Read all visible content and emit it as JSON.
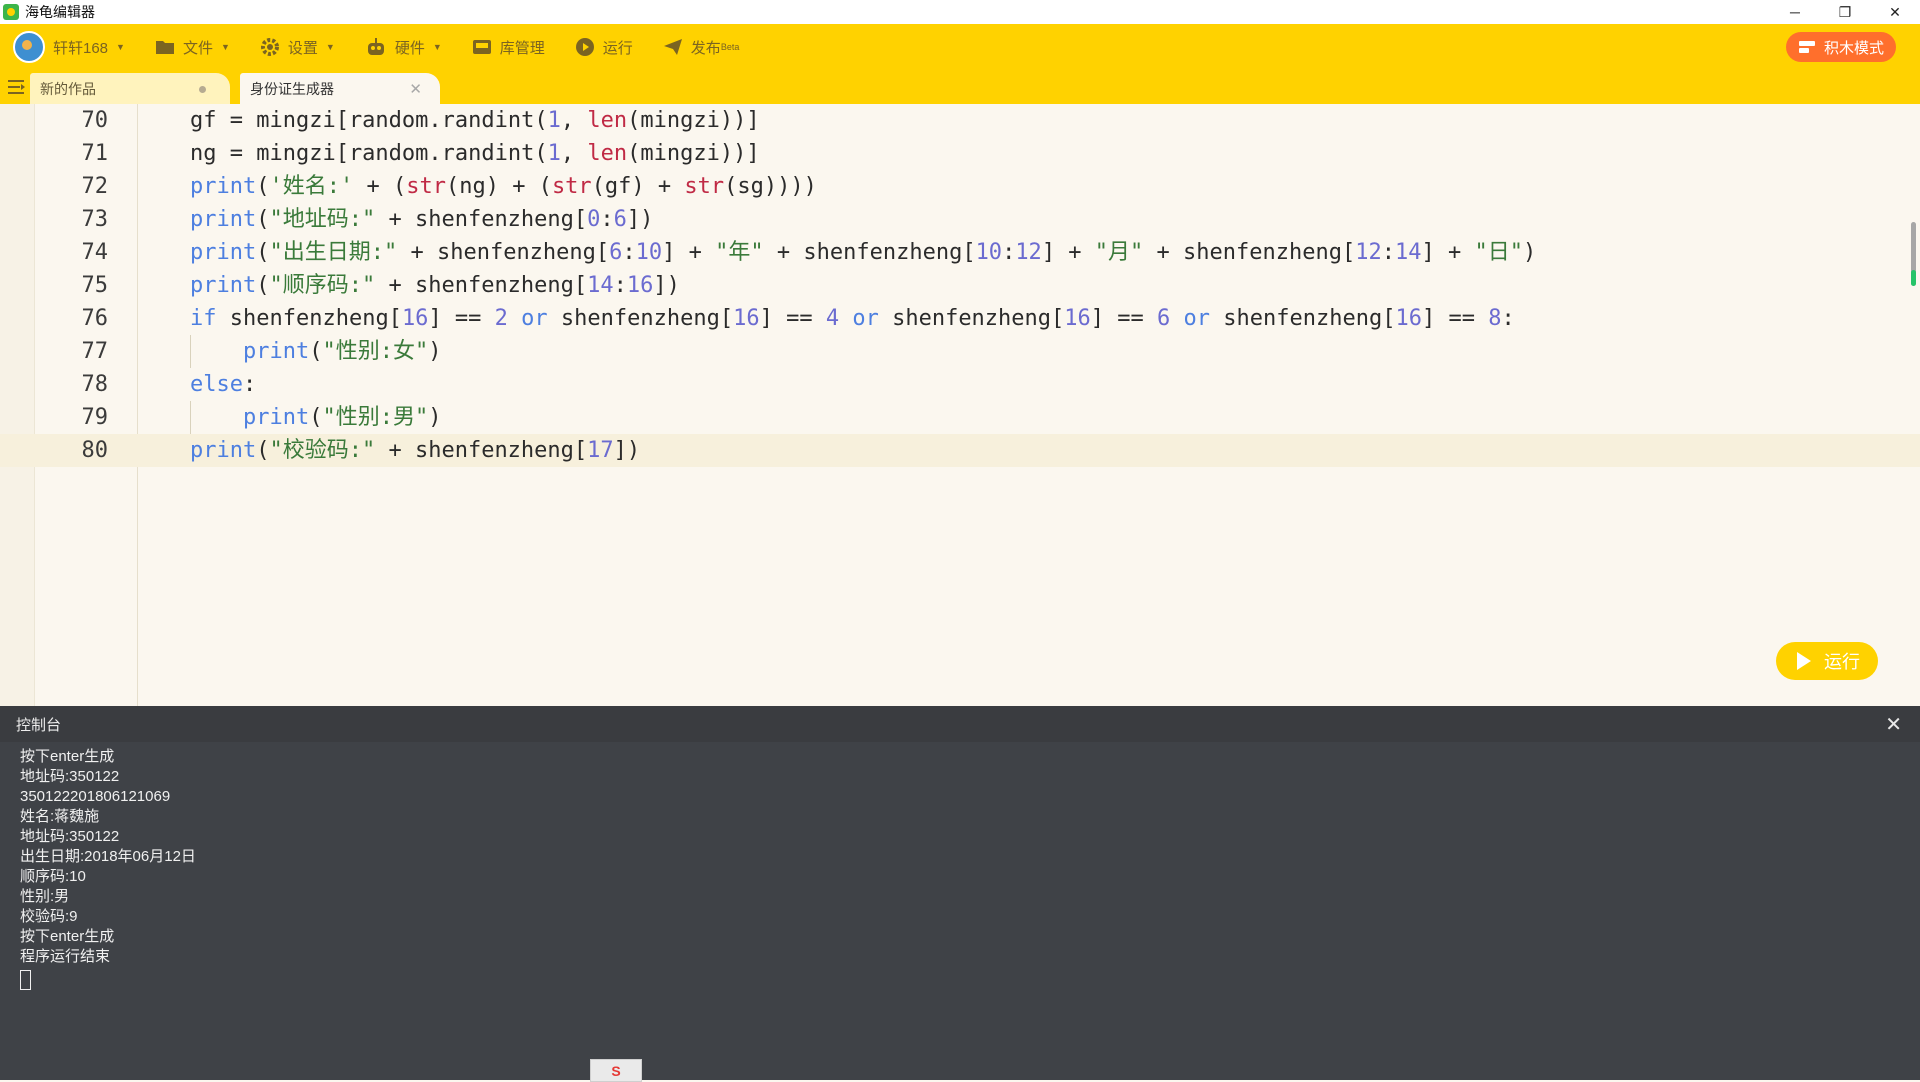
{
  "window": {
    "title": "海龟编辑器",
    "controls": {
      "minimize": "─",
      "restore": "❐",
      "close": "✕"
    }
  },
  "toolbar": {
    "user": "轩轩168",
    "file": "文件",
    "settings": "设置",
    "hardware": "硬件",
    "library": "库管理",
    "run": "运行",
    "publish": "发布",
    "publish_badge": "Beta",
    "block_mode": "积木模式"
  },
  "tabs": [
    {
      "label": "新的作品",
      "active": false
    },
    {
      "label": "身份证生成器",
      "active": true,
      "close": "✕"
    }
  ],
  "editor": {
    "active_line": 80,
    "run_button": "运行",
    "lines": [
      {
        "n": "70",
        "code": "gf = mingzi[random.randint(1, len(mingzi))]"
      },
      {
        "n": "71",
        "code": "ng = mingzi[random.randint(1, len(mingzi))]"
      },
      {
        "n": "72",
        "code": "print('姓名:' + (str(ng) + (str(gf) + str(sg))))"
      },
      {
        "n": "73",
        "code": "print(\"地址码:\" + shenfenzheng[0:6])"
      },
      {
        "n": "74",
        "code": "print(\"出生日期:\" + shenfenzheng[6:10] + \"年\" + shenfenzheng[10:12] + \"月\" + shenfenzheng[12:14] + \"日\")"
      },
      {
        "n": "75",
        "code": "print(\"顺序码:\" + shenfenzheng[14:16])"
      },
      {
        "n": "76",
        "code": "if shenfenzheng[16] == 2 or shenfenzheng[16] == 4 or shenfenzheng[16] == 6 or shenfenzheng[16] == 8:"
      },
      {
        "n": "77",
        "code": "    print(\"性别:女\")"
      },
      {
        "n": "78",
        "code": "else:"
      },
      {
        "n": "79",
        "code": "    print(\"性别:男\")"
      },
      {
        "n": "80",
        "code": "print(\"校验码:\" + shenfenzheng[17])"
      }
    ]
  },
  "console": {
    "title": "控制台",
    "close": "✕",
    "lines": [
      "按下enter生成",
      "地址码:350122",
      "350122201806121069",
      "姓名:蒋魏施",
      "地址码:350122",
      "出生日期:2018年06月12日",
      "顺序码:10",
      "性别:男",
      "校验码:9",
      "按下enter生成",
      "程序运行结束"
    ]
  },
  "ime": {
    "label": "S"
  },
  "colors": {
    "accent": "#ffd200",
    "block_mode": "#ff6f2c",
    "keyword": "#4d7fe0",
    "builtin": "#c02a45",
    "number": "#6b6bd0",
    "console_bg": "#3f4247"
  },
  "icons": [
    "app-logo-icon",
    "folder-icon",
    "gear-icon",
    "robot-icon",
    "library-icon",
    "play-circle-icon",
    "paper-plane-icon",
    "blocks-icon",
    "menu-icon",
    "play-icon",
    "close-icon"
  ]
}
